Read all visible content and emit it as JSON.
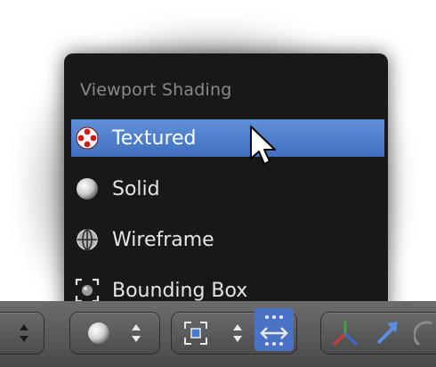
{
  "menu": {
    "title": "Viewport Shading",
    "items": [
      {
        "label": "Textured",
        "icon": "textured-icon",
        "active": true
      },
      {
        "label": "Solid",
        "icon": "solid-sphere-icon",
        "active": false
      },
      {
        "label": "Wireframe",
        "icon": "wireframe-sphere-icon",
        "active": false
      },
      {
        "label": "Bounding Box",
        "icon": "bounding-box-icon",
        "active": false
      }
    ]
  },
  "toolbar": {
    "items": [
      "updown-arrows-icon",
      "shading-sphere-icon",
      "pivot-point-icon",
      "snap-drag-icon",
      "transform-manipulator-icon",
      "translate-arrow-icon"
    ]
  },
  "colors": {
    "highlight": "#4a7acb",
    "menu_bg": "#181818",
    "toolbar_bg": "#5a5a5a"
  }
}
